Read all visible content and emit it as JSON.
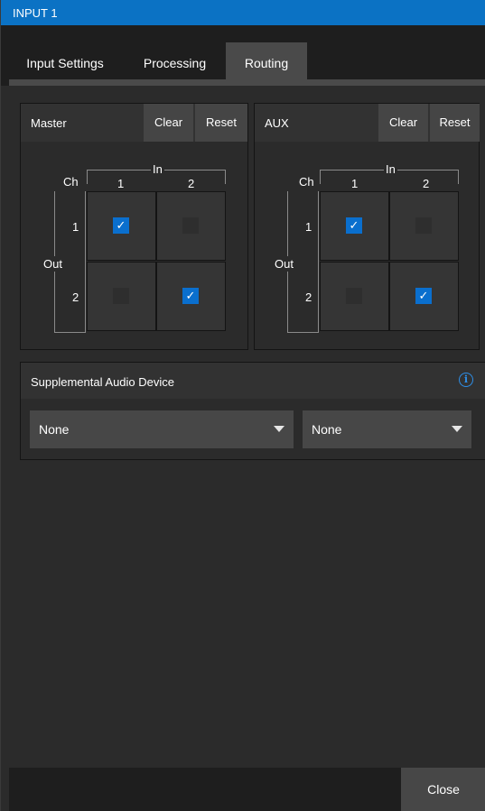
{
  "window": {
    "title": "INPUT 1"
  },
  "tabs": [
    {
      "label": "Input Settings"
    },
    {
      "label": "Processing"
    },
    {
      "label": "Routing",
      "active": true
    }
  ],
  "master": {
    "label": "Master",
    "clear_label": "Clear",
    "reset_label": "Reset",
    "ch_label": "Ch",
    "in_label": "In",
    "out_label": "Out",
    "cols": [
      "1",
      "2"
    ],
    "rows": [
      "1",
      "2"
    ],
    "matrix": [
      [
        true,
        false
      ],
      [
        false,
        true
      ]
    ]
  },
  "aux": {
    "label": "AUX",
    "clear_label": "Clear",
    "reset_label": "Reset",
    "ch_label": "Ch",
    "in_label": "In",
    "out_label": "Out",
    "cols": [
      "1",
      "2"
    ],
    "rows": [
      "1",
      "2"
    ],
    "matrix": [
      [
        true,
        false
      ],
      [
        false,
        true
      ]
    ]
  },
  "supplemental": {
    "label": "Supplemental Audio Device",
    "info_icon": "info-icon",
    "left_value": "None",
    "right_value": "None"
  },
  "footer": {
    "close_label": "Close"
  },
  "colors": {
    "accent": "#0b72c4",
    "check": "#0a6fce"
  },
  "check_glyph": "✓"
}
